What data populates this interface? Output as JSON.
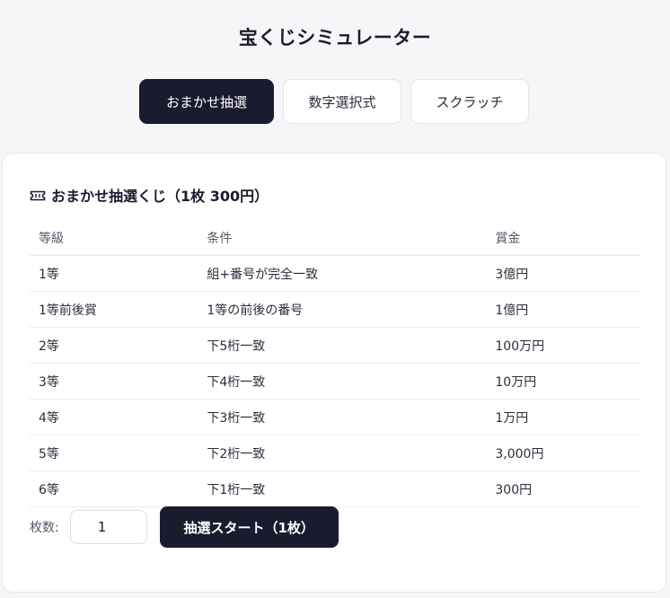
{
  "app": {
    "title": "宝くじシミュレーター"
  },
  "tabs": [
    {
      "label": "おまかせ抽選",
      "active": true
    },
    {
      "label": "数字選択式",
      "active": false
    },
    {
      "label": "スクラッチ",
      "active": false
    }
  ],
  "card": {
    "icon": "ticket-icon",
    "title": "おまかせ抽選くじ（1枚 300円）",
    "table": {
      "headers": [
        "等級",
        "条件",
        "賞金"
      ],
      "rows": [
        [
          "1等",
          "組+番号が完全一致",
          "3億円"
        ],
        [
          "1等前後賞",
          "1等の前後の番号",
          "1億円"
        ],
        [
          "2等",
          "下5桁一致",
          "100万円"
        ],
        [
          "3等",
          "下4桁一致",
          "10万円"
        ],
        [
          "4等",
          "下3桁一致",
          "1万円"
        ],
        [
          "5等",
          "下2桁一致",
          "3,000円"
        ],
        [
          "6等",
          "下1桁一致",
          "300円"
        ]
      ]
    },
    "controls": {
      "quantity_label": "枚数:",
      "quantity_value": "1",
      "start_button_label": "抽選スタート（1枚）"
    }
  },
  "colors": {
    "accent": "#1b1b30",
    "background": "#f6f6f8",
    "card": "#ffffff"
  }
}
